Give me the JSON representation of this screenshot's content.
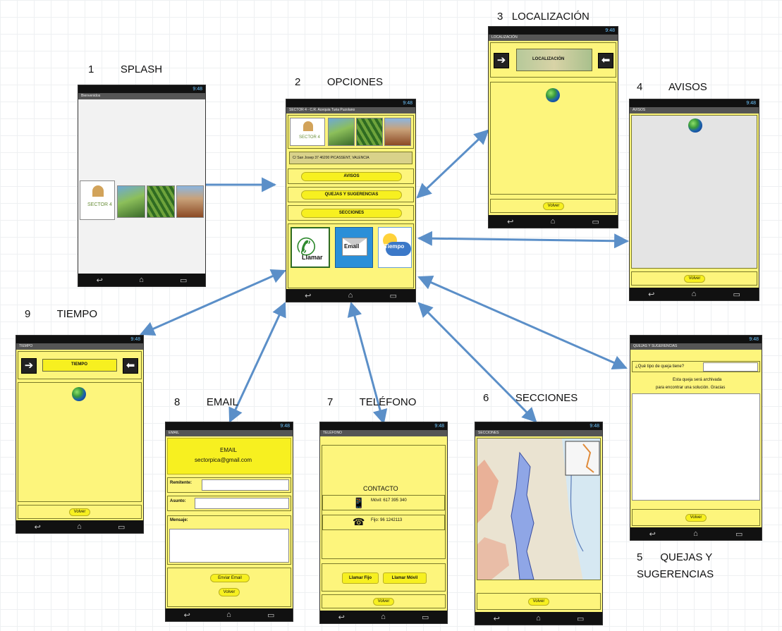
{
  "labels": {
    "splash": "1         SPLASH",
    "opciones": "2         OPCIONES",
    "localizacion": "3   LOCALIZACIÓN",
    "avisos": "4         AVISOS",
    "quejas_line1": "5      QUEJAS Y",
    "quejas_line2": "SUGERENCIAS",
    "secciones": "6         SECCIONES",
    "telefono": "7         TELÉFONO",
    "email": "8         EMAIL",
    "tiempo": "9         TIEMPO"
  },
  "status_time": "9:48",
  "nav_icons": [
    "back-icon",
    "home-icon",
    "recents-icon"
  ],
  "screens": {
    "splash": {
      "title": "Bienvenidos",
      "logo_text": "SECTOR 4"
    },
    "opciones": {
      "title": "SECTOR 4 - C.R. Acequia Turia Puzolano",
      "address": "C/ San Josep 37 46200 PICASSENT, VALENCIA",
      "buttons": [
        "AVISOS",
        "QUEJAS Y SUGERENCIAS",
        "SECCIONES"
      ],
      "icon_labels": [
        "Llamar",
        "Email",
        "Tiempo"
      ]
    },
    "localizacion": {
      "title": "LOCALIZACIÓN",
      "banner": "LOCALIZACIÓN",
      "back": "Volver"
    },
    "avisos": {
      "title": "AVISOS",
      "back": "Volver"
    },
    "quejas": {
      "title": "QUEJAS Y SUGERENCIAS",
      "question": "¿Qué tipo de queja tiene?",
      "note_line1": "Esta queja será archivada",
      "note_line2": "para encontrar una solución. Gracias",
      "back": "Volver"
    },
    "secciones": {
      "title": "SECCIONES",
      "back": "Volver"
    },
    "telefono": {
      "title": "TELÉFONO",
      "heading": "CONTACTO",
      "mobile": "Móvil: 617 395 340",
      "landline": "Fijo: 96 1242113",
      "call_fijo": "Llamar Fijo",
      "call_movil": "Llamar Móvil",
      "back": "Volver"
    },
    "email": {
      "title": "EMAIL",
      "heading": "EMAIL",
      "address": "sectorpica@gmail.com",
      "from_label": "Remitente:",
      "subject_label": "Asunto:",
      "message_label": "Mensaje:",
      "send": "Enviar Email",
      "back": "Volver"
    },
    "tiempo": {
      "title": "TIEMPO",
      "banner": "TIEMPO",
      "back": "Volver"
    }
  },
  "colors": {
    "panel_yellow": "#fdf57c",
    "button_yellow": "#f7f020",
    "arrow_blue": "#5b8fc8"
  }
}
